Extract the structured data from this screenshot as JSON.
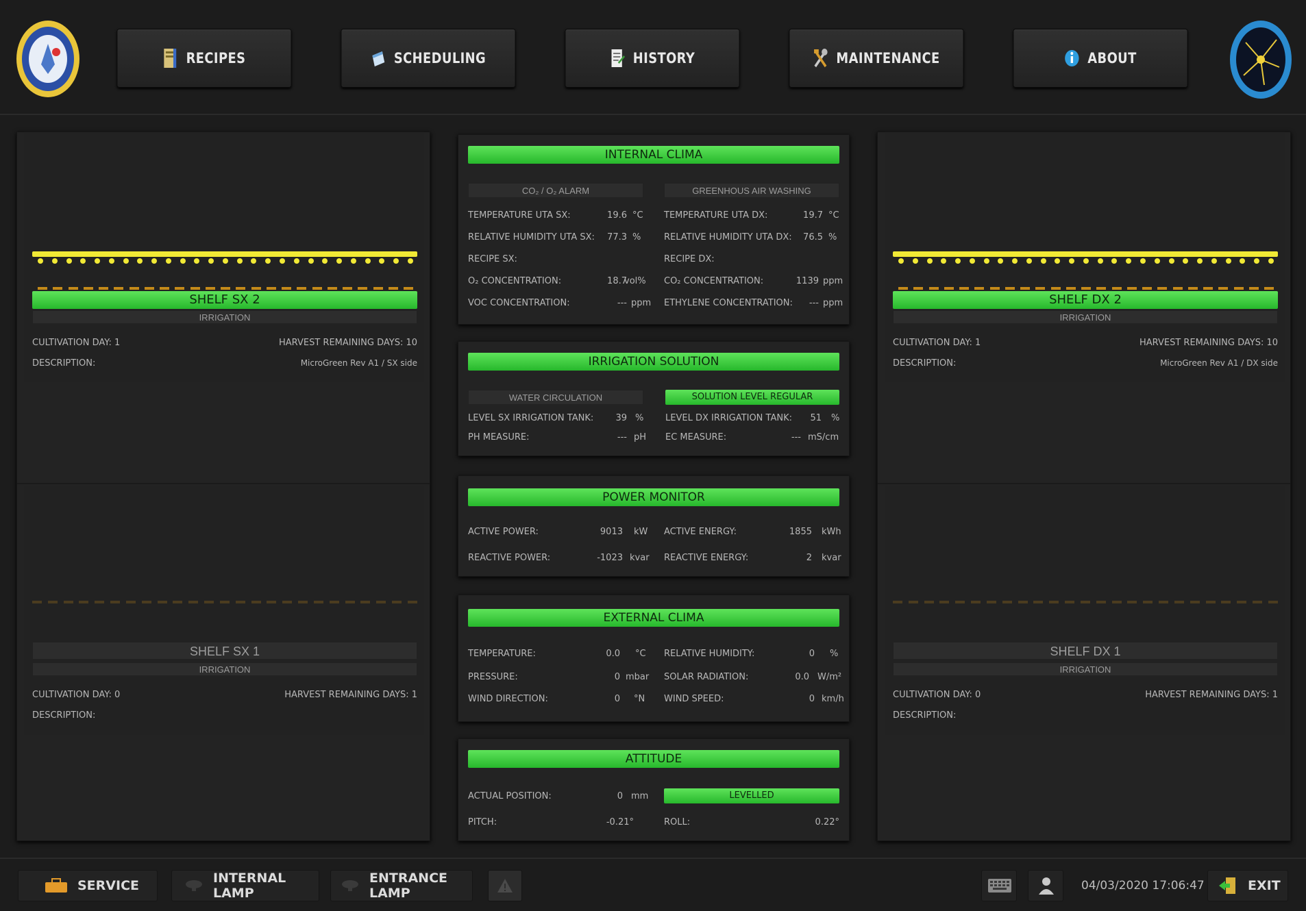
{
  "nav": [
    {
      "label": "RECIPES",
      "icon": "recipe-book-icon"
    },
    {
      "label": "SCHEDULING",
      "icon": "schedule-icon"
    },
    {
      "label": "HISTORY",
      "icon": "history-icon"
    },
    {
      "label": "MAINTENANCE",
      "icon": "tools-icon"
    },
    {
      "label": "ABOUT",
      "icon": "info-icon"
    }
  ],
  "colors": {
    "accent_green": "#35d13c",
    "lamp_yellow": "#f1e935"
  },
  "left": {
    "top_shelf": {
      "title": "SHELF SX 2",
      "irrigation": "IRRIGATION",
      "cultivation_day": "CULTIVATION DAY: 1",
      "harvest": "HARVEST REMAINING DAYS: 10",
      "description_label": "DESCRIPTION:",
      "description_value": "MicroGreen Rev A1 / SX side"
    },
    "bottom_shelf": {
      "title": "SHELF SX 1",
      "irrigation": "IRRIGATION",
      "cultivation_day": "CULTIVATION DAY: 0",
      "harvest": "HARVEST REMAINING DAYS: 1",
      "description_label": "DESCRIPTION:"
    }
  },
  "right": {
    "top_shelf": {
      "title": "SHELF DX 2",
      "irrigation": "IRRIGATION",
      "cultivation_day": "CULTIVATION DAY: 1",
      "harvest": "HARVEST REMAINING DAYS: 10",
      "description_label": "DESCRIPTION:",
      "description_value": "MicroGreen Rev A1 / DX side"
    },
    "bottom_shelf": {
      "title": "SHELF DX 1",
      "irrigation": "IRRIGATION",
      "cultivation_day": "CULTIVATION DAY: 0",
      "harvest": "HARVEST REMAINING DAYS: 1",
      "description_label": "DESCRIPTION:"
    }
  },
  "internal_clima": {
    "title": "INTERNAL CLIMA",
    "alarm_left": "CO₂ / O₂ ALARM",
    "alarm_right": "GREENHOUS AIR WASHING",
    "rows_left": [
      {
        "label": "TEMPERATURE UTA SX:",
        "value": "19.6",
        "unit": "°C"
      },
      {
        "label": "RELATIVE HUMIDITY UTA SX:",
        "value": "77.3",
        "unit": "%"
      },
      {
        "label": "RECIPE SX:",
        "value": "",
        "unit": ""
      },
      {
        "label": "O₂ CONCENTRATION:",
        "value": "18.7",
        "unit": "vol%"
      },
      {
        "label": "VOC CONCENTRATION:",
        "value": "---",
        "unit": "ppm"
      }
    ],
    "rows_right": [
      {
        "label": "TEMPERATURE UTA DX:",
        "value": "19.7",
        "unit": "°C"
      },
      {
        "label": "RELATIVE HUMIDITY UTA DX:",
        "value": "76.5",
        "unit": "%"
      },
      {
        "label": "RECIPE DX:",
        "value": "",
        "unit": ""
      },
      {
        "label": "CO₂ CONCENTRATION:",
        "value": "1139",
        "unit": "ppm"
      },
      {
        "label": "ETHYLENE CONCENTRATION:",
        "value": "---",
        "unit": "ppm"
      }
    ]
  },
  "irrigation_solution": {
    "title": "IRRIGATION SOLUTION",
    "status_left": "WATER CIRCULATION",
    "status_right": "SOLUTION LEVEL REGULAR",
    "rows_left": [
      {
        "label": "LEVEL SX IRRIGATION TANK:",
        "value": "39",
        "unit": "%"
      },
      {
        "label": "PH MEASURE:",
        "value": "---",
        "unit": "pH"
      }
    ],
    "rows_right": [
      {
        "label": "LEVEL DX IRRIGATION TANK:",
        "value": "51",
        "unit": "%"
      },
      {
        "label": "EC MEASURE:",
        "value": "---",
        "unit": "mS/cm"
      }
    ]
  },
  "power_monitor": {
    "title": "POWER MONITOR",
    "rows_left": [
      {
        "label": "ACTIVE POWER:",
        "value": "9013",
        "unit": "kW"
      },
      {
        "label": "REACTIVE POWER:",
        "value": "-1023",
        "unit": "kvar"
      }
    ],
    "rows_right": [
      {
        "label": "ACTIVE ENERGY:",
        "value": "1855",
        "unit": "kWh"
      },
      {
        "label": "REACTIVE ENERGY:",
        "value": "2",
        "unit": "kvar"
      }
    ]
  },
  "external_clima": {
    "title": "EXTERNAL CLIMA",
    "rows_left": [
      {
        "label": "TEMPERATURE:",
        "value": "0.0",
        "unit": "°C"
      },
      {
        "label": "PRESSURE:",
        "value": "0",
        "unit": "mbar"
      },
      {
        "label": "WIND DIRECTION:",
        "value": "0",
        "unit": "°N"
      }
    ],
    "rows_right": [
      {
        "label": "RELATIVE HUMIDITY:",
        "value": "0",
        "unit": "%"
      },
      {
        "label": "SOLAR RADIATION:",
        "value": "0.0",
        "unit": "W/m²"
      },
      {
        "label": "WIND SPEED:",
        "value": "0",
        "unit": "km/h"
      }
    ]
  },
  "attitude": {
    "title": "ATTITUDE",
    "actual_position_label": "ACTUAL POSITION:",
    "actual_position_value": "0",
    "actual_position_unit": "mm",
    "status": "LEVELLED",
    "pitch_label": "PITCH:",
    "pitch_value": "-0.21°",
    "roll_label": "ROLL:",
    "roll_value": "0.22°"
  },
  "bottom": {
    "service": "SERVICE",
    "internal_lamp": "INTERNAL LAMP",
    "entrance_lamp": "ENTRANCE LAMP",
    "datetime": "04/03/2020 17:06:47",
    "exit": "EXIT"
  }
}
